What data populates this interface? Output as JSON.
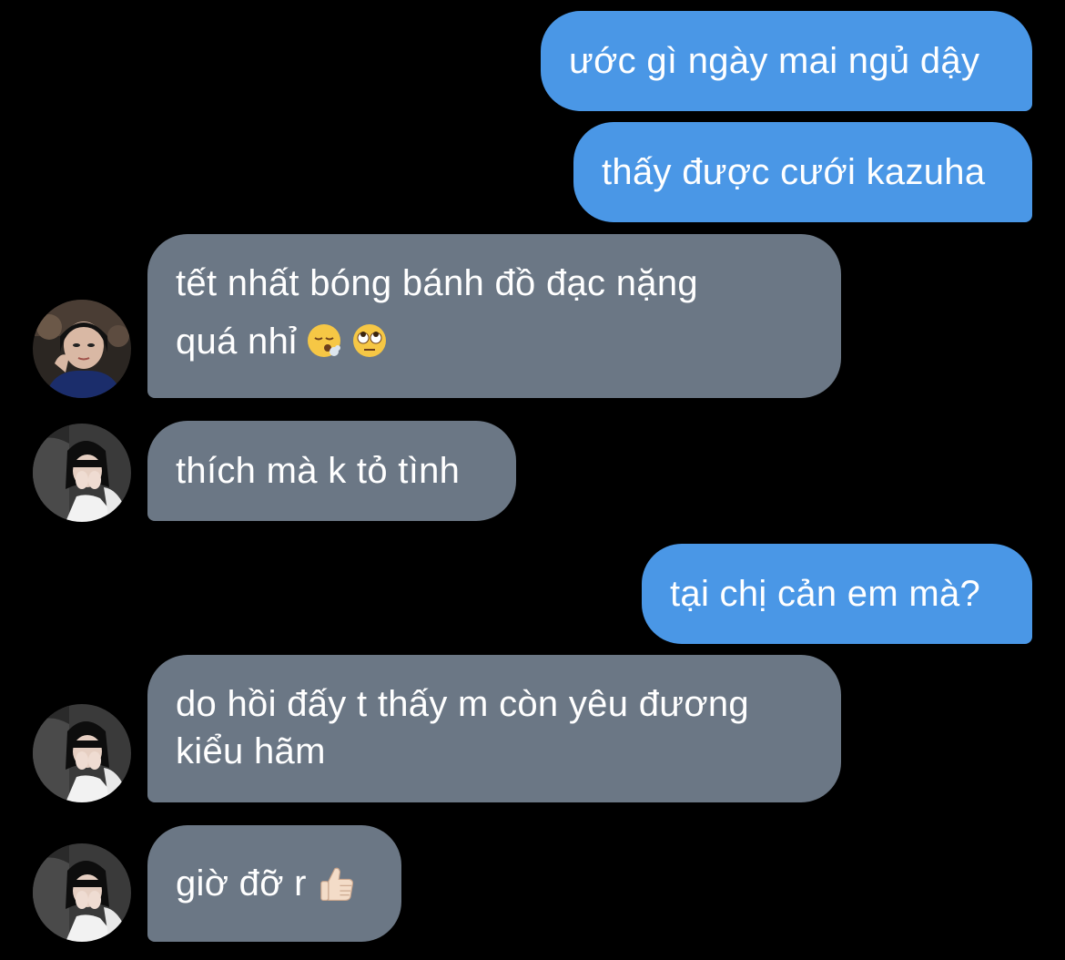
{
  "messages": [
    {
      "side": "out",
      "text": "ước gì ngày mai ngủ dậy"
    },
    {
      "side": "out",
      "text": "thấy được cưới kazuha"
    },
    {
      "side": "in",
      "lines": [
        "tết nhất bóng bánh đồ đạc nặng",
        "quá nhỉ"
      ],
      "emojis": [
        "face-exhaling-emoji",
        "face-rolling-eyes-emoji"
      ],
      "avatar": "avatar-dark-outfit"
    },
    {
      "side": "in",
      "text": "thích mà k tỏ tình",
      "avatar": "avatar-covering-face"
    },
    {
      "side": "out",
      "text": "tại chị cản em mà?"
    },
    {
      "side": "in",
      "lines": [
        "do hồi đấy t thấy m còn yêu đương",
        "kiểu hãm"
      ],
      "avatar": "avatar-covering-face"
    },
    {
      "side": "in",
      "text": "giờ đỡ r",
      "emojis": [
        "thumbs-up-light-skin-emoji"
      ],
      "avatar": "avatar-covering-face"
    }
  ],
  "colors": {
    "background": "#000000",
    "outgoing_bubble": "#4a97e6",
    "incoming_bubble": "#6b7785",
    "text": "#ffffff"
  }
}
